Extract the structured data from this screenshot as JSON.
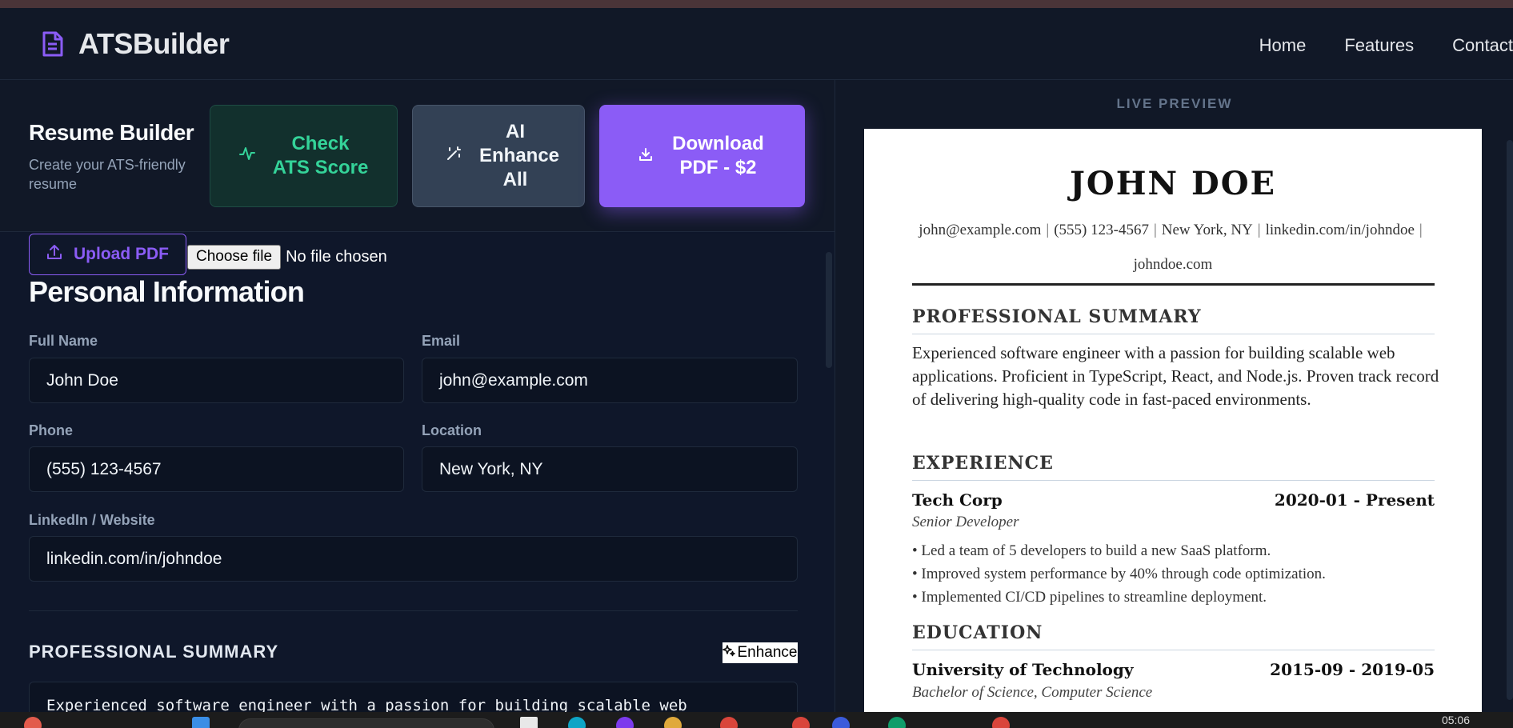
{
  "app": {
    "name": "ATSBuilder",
    "nav": [
      "Home",
      "Features",
      "Contact"
    ]
  },
  "builder": {
    "title": "Resume Builder",
    "subtitle": "Create your ATS-friendly resume",
    "buttons": {
      "ats": "Check ATS Score",
      "ai": "AI Enhance All",
      "download": "Download PDF - $2"
    },
    "upload_label": "Upload PDF",
    "file_choose_label": "Choose file",
    "file_status": "No file chosen",
    "section_title": "Personal Information",
    "fields": {
      "full_name": {
        "label": "Full Name",
        "value": "John Doe"
      },
      "email": {
        "label": "Email",
        "value": "john@example.com"
      },
      "phone": {
        "label": "Phone",
        "value": "(555) 123-4567"
      },
      "location": {
        "label": "Location",
        "value": "New York, NY"
      },
      "linkedin": {
        "label": "LinkedIn / Website",
        "value": "linkedin.com/in/johndoe"
      }
    },
    "summary_title": "PROFESSIONAL SUMMARY",
    "enhance_label": "Enhance",
    "summary_text": "Experienced software engineer with a passion for building scalable web"
  },
  "preview": {
    "label": "LIVE PREVIEW",
    "name": "JOHN DOE",
    "contact": {
      "email": "john@example.com",
      "phone": "(555) 123-4567",
      "location": "New York, NY",
      "linkedin": "linkedin.com/in/johndoe",
      "website": "johndoe.com"
    },
    "summary_heading": "PROFESSIONAL SUMMARY",
    "summary": "Experienced software engineer with a passion for building scalable web applications. Proficient in TypeScript, React, and Node.js. Proven track record of delivering high-quality code in fast-paced environments.",
    "experience_heading": "EXPERIENCE",
    "experience": {
      "company": "Tech Corp",
      "dates": "2020-01 - Present",
      "role": "Senior Developer",
      "bullets": [
        "• Led a team of 5 developers to build a new SaaS platform.",
        "• Improved system performance by 40% through code optimization.",
        "• Implemented CI/CD pipelines to streamline deployment."
      ]
    },
    "education_heading": "EDUCATION",
    "education": {
      "school": "University of Technology",
      "dates": "2015-09 - 2019-05",
      "degree": "Bachelor of Science, Computer Science"
    }
  },
  "taskbar": {
    "time": "05:06"
  },
  "colors": {
    "accent": "#8b5cf6",
    "ats_green": "#34d399",
    "background": "#0f172a"
  }
}
